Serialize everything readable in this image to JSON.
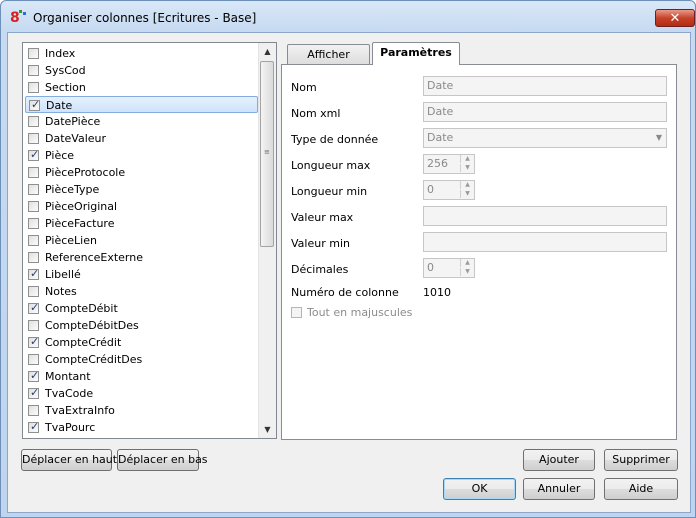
{
  "window": {
    "title": "Organiser colonnes [Ecritures - Base]",
    "app_icon_glyph": "8",
    "close_label": "✕"
  },
  "columns": [
    {
      "label": "Index",
      "checked": false
    },
    {
      "label": "SysCod",
      "checked": false
    },
    {
      "label": "Section",
      "checked": false
    },
    {
      "label": "Date",
      "checked": true,
      "selected": true
    },
    {
      "label": "DatePièce",
      "checked": false
    },
    {
      "label": "DateValeur",
      "checked": false
    },
    {
      "label": "Pièce",
      "checked": true
    },
    {
      "label": "PièceProtocole",
      "checked": false
    },
    {
      "label": "PièceType",
      "checked": false
    },
    {
      "label": "PièceOriginal",
      "checked": false
    },
    {
      "label": "PièceFacture",
      "checked": false
    },
    {
      "label": "PièceLien",
      "checked": false
    },
    {
      "label": "ReferenceExterne",
      "checked": false
    },
    {
      "label": "Libellé",
      "checked": true
    },
    {
      "label": "Notes",
      "checked": false
    },
    {
      "label": "CompteDébit",
      "checked": true
    },
    {
      "label": "CompteDébitDes",
      "checked": false
    },
    {
      "label": "CompteCrédit",
      "checked": true
    },
    {
      "label": "CompteCréditDes",
      "checked": false
    },
    {
      "label": "Montant",
      "checked": true
    },
    {
      "label": "TvaCode",
      "checked": true
    },
    {
      "label": "TvaExtraInfo",
      "checked": false
    },
    {
      "label": "TvaPourc",
      "checked": true
    }
  ],
  "buttons": {
    "move_up": "Déplacer en haut",
    "move_down": "Déplacer en bas",
    "add": "Ajouter",
    "delete": "Supprimer",
    "ok": "OK",
    "cancel": "Annuler",
    "help": "Aide"
  },
  "tabs": [
    {
      "label": "Afficher",
      "active": false
    },
    {
      "label": "Paramètres",
      "active": true
    }
  ],
  "params": {
    "nom_label": "Nom",
    "nom_value": "Date",
    "nomxml_label": "Nom xml",
    "nomxml_value": "Date",
    "type_label": "Type de donnée",
    "type_value": "Date",
    "longmax_label": "Longueur max",
    "longmax_value": "256",
    "longmin_label": "Longueur min",
    "longmin_value": "0",
    "valmax_label": "Valeur max",
    "valmax_value": "",
    "valmin_label": "Valeur min",
    "valmin_value": "",
    "dec_label": "Décimales",
    "dec_value": "0",
    "numcol_label": "Numéro de colonne",
    "numcol_value": "1010",
    "uppercase_label": "Tout en majuscules"
  }
}
